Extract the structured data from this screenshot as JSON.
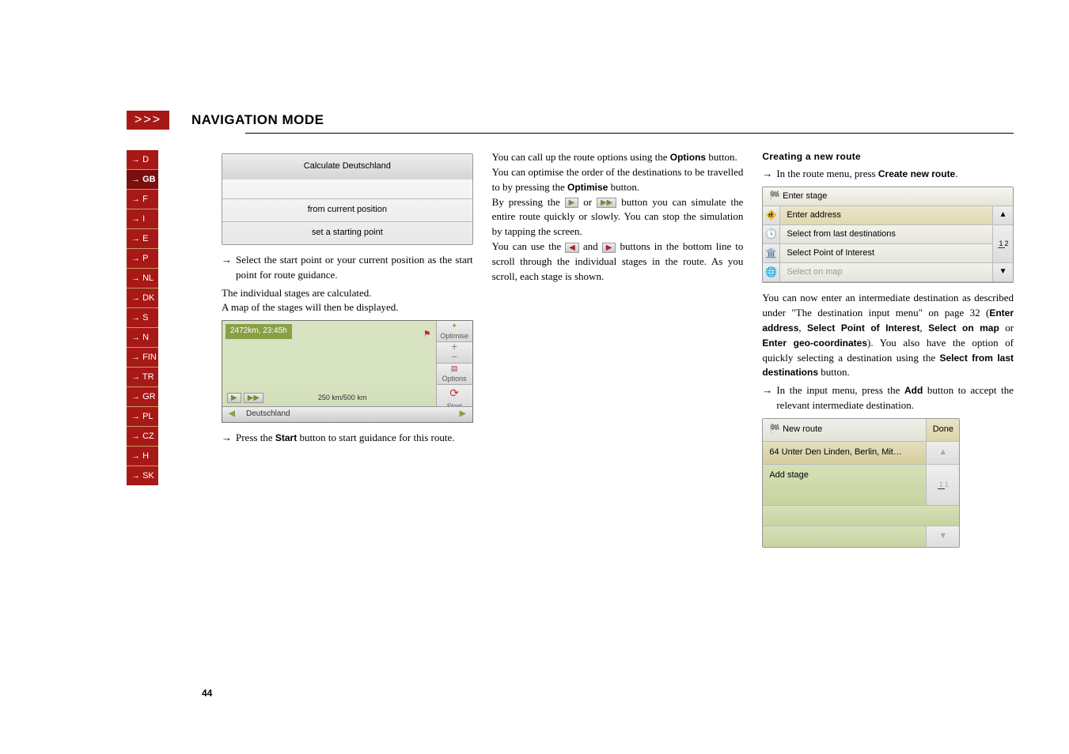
{
  "header": {
    "arrows": ">>>",
    "title": "NAVIGATION MODE"
  },
  "sidetabs": [
    "D",
    "GB",
    "F",
    "I",
    "E",
    "P",
    "NL",
    "DK",
    "S",
    "N",
    "FIN",
    "TR",
    "GR",
    "PL",
    "CZ",
    "H",
    "SK"
  ],
  "active_tab_index": 1,
  "page_number": "44",
  "col1": {
    "calc_title": "Calculate Deutschland",
    "from_current": "from current position",
    "set_start": "set a starting point",
    "bullet1": "Select the start point or your current position as the start point for route guidance.",
    "p1": "The individual stages are calculated.",
    "p2": "A map of the stages will then be displayed.",
    "map_title": "2472km, 23:45h",
    "map_opt": "Optimise",
    "map_options": "Options",
    "map_start": "Start",
    "map_scale": "250 km/500 km",
    "map_label": "Deutschland",
    "bullet2_a": "Press the ",
    "bullet2_start": "Start",
    "bullet2_b": " button to start guidance for this route."
  },
  "col2": {
    "p1a": "You can call up the route options using the ",
    "p1_options": "Options",
    "p1b": " button.",
    "p2a": "You can optimise the order of the destinations to be travelled to by pressing the ",
    "p2_optimise": "Optimise",
    "p2b": " button.",
    "p3a": "By pressing the ",
    "p3b": " or ",
    "p3c": " button you can simulate the entire route quickly or slowly. You can stop the simulation by tapping the screen.",
    "p4a": "You can use the ",
    "p4b": " and ",
    "p4c": " buttons in the bottom line to scroll through the individual stages in the route. As you scroll, each stage is shown."
  },
  "col3": {
    "heading": "Creating a new route",
    "b1a": "In the route menu, press ",
    "b1_create": "Create new route",
    "b1b": ".",
    "es_title": "Enter stage",
    "es_r1": "Enter address",
    "es_r2": "Select from last destinations",
    "es_r3": "Select Point of Interest",
    "es_r4": "Select on map",
    "p2a": "You can now enter an intermediate destination as described under \"The destination input menu\" on page 32 (",
    "p2_enter_address": "Enter address",
    "p2_sep1": ", ",
    "p2_spoi": "Select Point of Interest",
    "p2_sep2": ", ",
    "p2_som": "Select on map",
    "p2_or": " or ",
    "p2_geo": "Enter geo-coordinates",
    "p2b": "). You also have the option of quickly selecting a destination using the ",
    "p2_sfl": "Select from last destinations",
    "p2c": " button.",
    "b2a": "In the input menu, press the ",
    "b2_add": "Add",
    "b2b": " button to accept the relevant intermediate destination.",
    "nr_title": "New route",
    "nr_done": "Done",
    "nr_r1": "64 Unter Den Linden, Berlin, Mit…",
    "nr_r2": "Add stage"
  }
}
